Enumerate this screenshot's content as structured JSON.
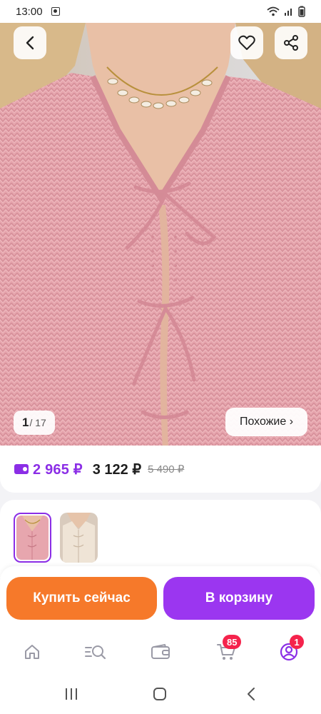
{
  "status_bar": {
    "time": "13:00"
  },
  "hero": {
    "counter_current": "1",
    "counter_total": "/ 17",
    "similar_label": "Похожие ›"
  },
  "price": {
    "wallet_price": "2 965 ₽",
    "price": "3 122 ₽",
    "old_price": "5 490 ₽"
  },
  "actions": {
    "buy_now": "Купить сейчас",
    "add_to_cart": "В корзину"
  },
  "bottom_nav": {
    "items": [
      {
        "icon": "home-icon"
      },
      {
        "icon": "catalog-search-icon"
      },
      {
        "icon": "wallet-icon"
      },
      {
        "icon": "cart-icon",
        "badge": "85"
      },
      {
        "icon": "profile-icon",
        "badge": "1"
      }
    ]
  },
  "colors": {
    "accent": "#8b2ee6",
    "buy_button": "#f6792a",
    "cart_button": "#9b36f0",
    "badge": "#f5234c"
  }
}
